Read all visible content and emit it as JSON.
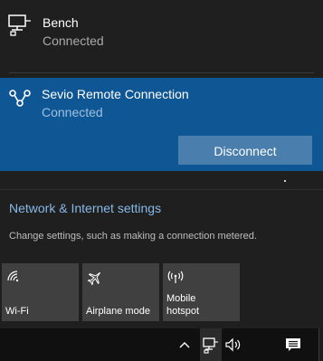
{
  "networks": [
    {
      "name": "Bench",
      "status": "Connected",
      "icon": "ethernet-icon"
    },
    {
      "name": "Sevio Remote Connection",
      "status": "Connected",
      "icon": "vpn-icon",
      "selected": true
    }
  ],
  "disconnect_label": "Disconnect",
  "settings": {
    "link_label": "Network & Internet settings",
    "description": "Change settings, such as making a connection metered."
  },
  "quick_actions": [
    {
      "label": "Wi-Fi",
      "icon": "wifi-icon"
    },
    {
      "label": "Airplane mode",
      "icon": "airplane-icon"
    },
    {
      "label": "Mobile\nhotspot",
      "icon": "hotspot-icon"
    }
  ],
  "colors": {
    "flyout_bg": "#1f1f1f",
    "selected_bg": "#0f5695",
    "button_bg": "#4a7ead",
    "link": "#88b8e8",
    "tile_bg": "#404040",
    "taskbar_bg": "#101010"
  },
  "taskbar": {
    "icons": [
      "chevron-up-icon",
      "network-icon",
      "volume-icon",
      "action-center-icon"
    ]
  }
}
